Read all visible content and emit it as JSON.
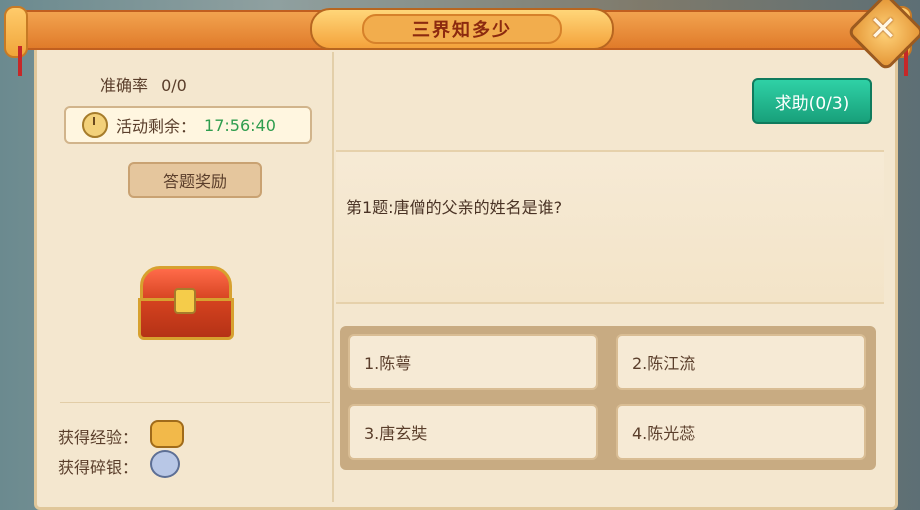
{
  "title": "三界知多少",
  "close_icon": "close-icon",
  "left": {
    "accuracy_label": "准确率",
    "accuracy_value": "0/0",
    "timer_label": "活动剩余：",
    "timer_value": "17:56:40",
    "reward_label": "答题奖励",
    "exp_label": "获得经验：",
    "silver_label": "获得碎银："
  },
  "help_button": "求助(0/3)",
  "question": "第1题:唐僧的父亲的姓名是谁?",
  "options": [
    "1.陈萼",
    "2.陈江流",
    "3.唐玄奘",
    "4.陈光蕊"
  ],
  "colors": {
    "accent_orange": "#e07b2a",
    "help_green": "#18a07a",
    "timer_green": "#2f9d4e",
    "parchment": "#f4e7cf"
  }
}
